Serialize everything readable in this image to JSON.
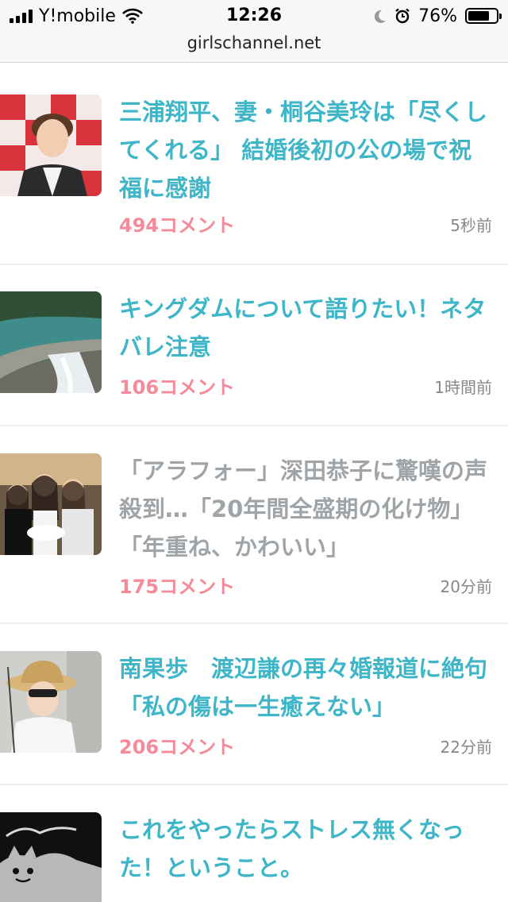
{
  "status_bar": {
    "carrier": "Y!mobile",
    "time": "12:26",
    "battery": "76%",
    "battery_level": 0.76,
    "icons": [
      "signal-icon",
      "wifi-icon",
      "moon-icon",
      "alarm-icon",
      "battery-icon"
    ]
  },
  "browser": {
    "domain": "girlschannel.net"
  },
  "colors": {
    "title": "#3eb6c8",
    "title_visited": "#9ea4a8",
    "comment_count": "#f58a98",
    "time": "#888888"
  },
  "articles": [
    {
      "title": "三浦翔平、妻・桐谷美玲は「尽くしてくれる」 結婚後初の公の場で祝福に感謝",
      "comments": "494コメント",
      "time": "5秒前"
    },
    {
      "title": "キングダムについて語りたい！ネタバレ注意",
      "comments": "106コメント",
      "time": "1時間前"
    },
    {
      "title": "「アラフォー」深田恭子に驚嘆の声殺到…「20年間全盛期の化け物」「年重ね、かわいい」",
      "comments": "175コメント",
      "time": "20分前"
    },
    {
      "title": "南果歩　渡辺謙の再々婚報道に絶句「私の傷は一生癒えない」",
      "comments": "206コメント",
      "time": "22分前"
    },
    {
      "title": "これをやったらストレス無くなった！ということ。",
      "comments": "",
      "time": ""
    }
  ]
}
